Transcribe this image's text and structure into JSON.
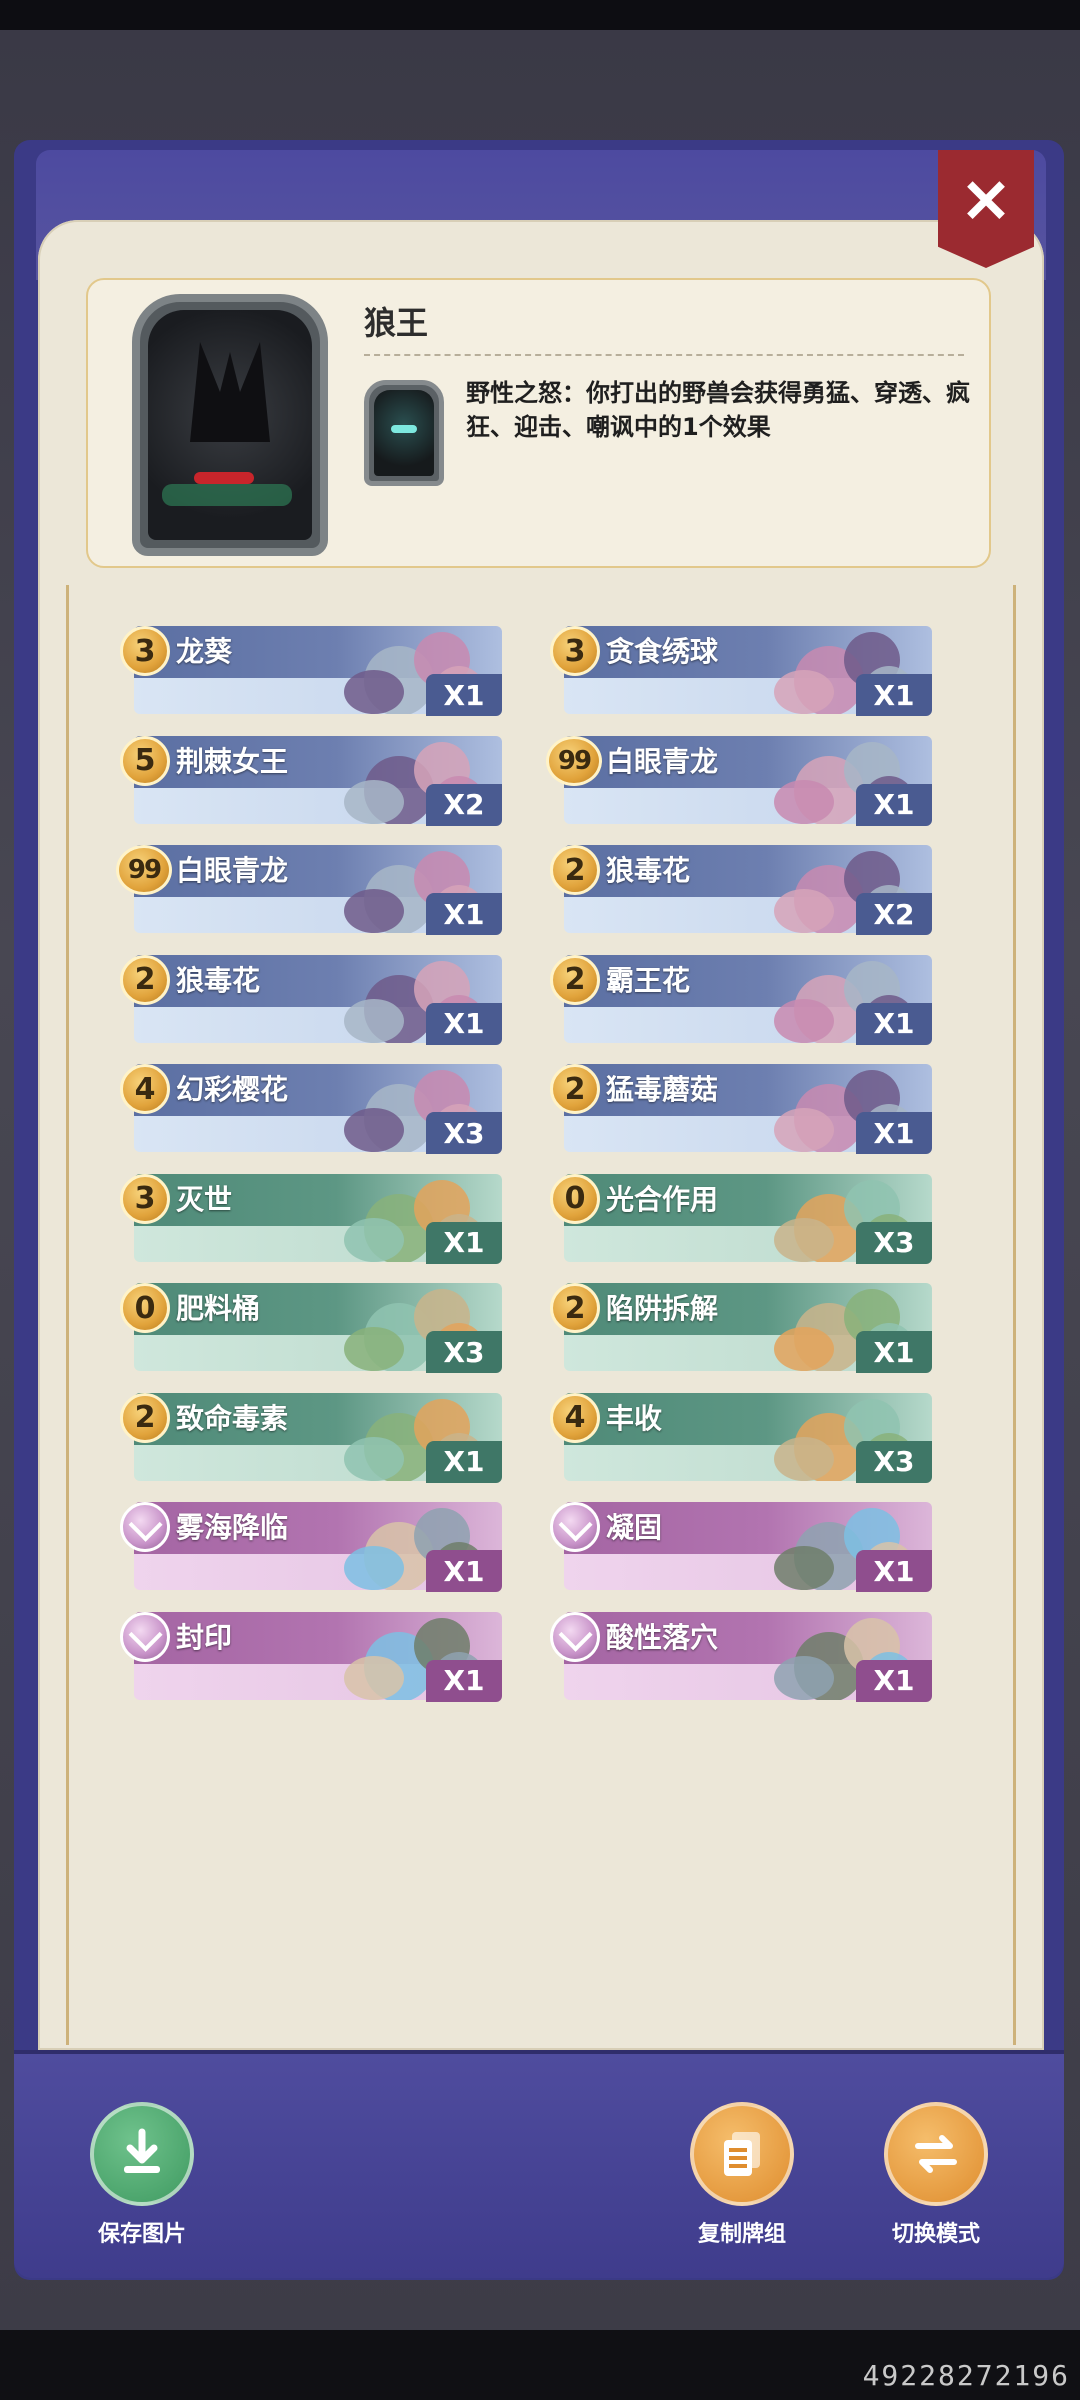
{
  "hero": {
    "name": "狼王",
    "skill_name": "野性之怒",
    "skill_text": "野性之怒：你打出的野兽会获得勇猛、穿透、疯狂、迎击、嘲讽中的1个效果"
  },
  "close_label": "✕",
  "cards": [
    {
      "cost": "3",
      "name": "龙葵",
      "qty": "X1",
      "type": "blue"
    },
    {
      "cost": "3",
      "name": "贪食绣球",
      "qty": "X1",
      "type": "blue"
    },
    {
      "cost": "5",
      "name": "荆棘女王",
      "qty": "X2",
      "type": "blue"
    },
    {
      "cost": "99",
      "name": "白眼青龙",
      "qty": "X1",
      "type": "blue"
    },
    {
      "cost": "99",
      "name": "白眼青龙",
      "qty": "X1",
      "type": "blue"
    },
    {
      "cost": "2",
      "name": "狼毒花",
      "qty": "X2",
      "type": "blue"
    },
    {
      "cost": "2",
      "name": "狼毒花",
      "qty": "X1",
      "type": "blue"
    },
    {
      "cost": "2",
      "name": "霸王花",
      "qty": "X1",
      "type": "blue"
    },
    {
      "cost": "4",
      "name": "幻彩樱花",
      "qty": "X3",
      "type": "blue"
    },
    {
      "cost": "2",
      "name": "猛毒蘑菇",
      "qty": "X1",
      "type": "blue"
    },
    {
      "cost": "3",
      "name": "灭世",
      "qty": "X1",
      "type": "green"
    },
    {
      "cost": "0",
      "name": "光合作用",
      "qty": "X3",
      "type": "green"
    },
    {
      "cost": "0",
      "name": "肥料桶",
      "qty": "X3",
      "type": "green"
    },
    {
      "cost": "2",
      "name": "陷阱拆解",
      "qty": "X1",
      "type": "green"
    },
    {
      "cost": "2",
      "name": "致命毒素",
      "qty": "X1",
      "type": "green"
    },
    {
      "cost": "4",
      "name": "丰收",
      "qty": "X3",
      "type": "green"
    },
    {
      "cost": "",
      "name": "雾海降临",
      "qty": "X1",
      "type": "pink"
    },
    {
      "cost": "",
      "name": "凝固",
      "qty": "X1",
      "type": "pink"
    },
    {
      "cost": "",
      "name": "封印",
      "qty": "X1",
      "type": "pink"
    },
    {
      "cost": "",
      "name": "酸性落穴",
      "qty": "X1",
      "type": "pink"
    }
  ],
  "actions": {
    "save_label": "保存图片",
    "copy_label": "复制牌组",
    "switch_label": "切换模式"
  },
  "watermark": "49228272196",
  "colors": {
    "panel_purple": "#3b3a86",
    "parchment": "#ece7d8",
    "close_red": "#9b2a30",
    "creature_blue": "#5b6fa2",
    "spell_green": "#4f8a78",
    "trap_pink": "#a465a3",
    "save_green": "#3f9a61",
    "action_orange": "#df8d2e"
  }
}
